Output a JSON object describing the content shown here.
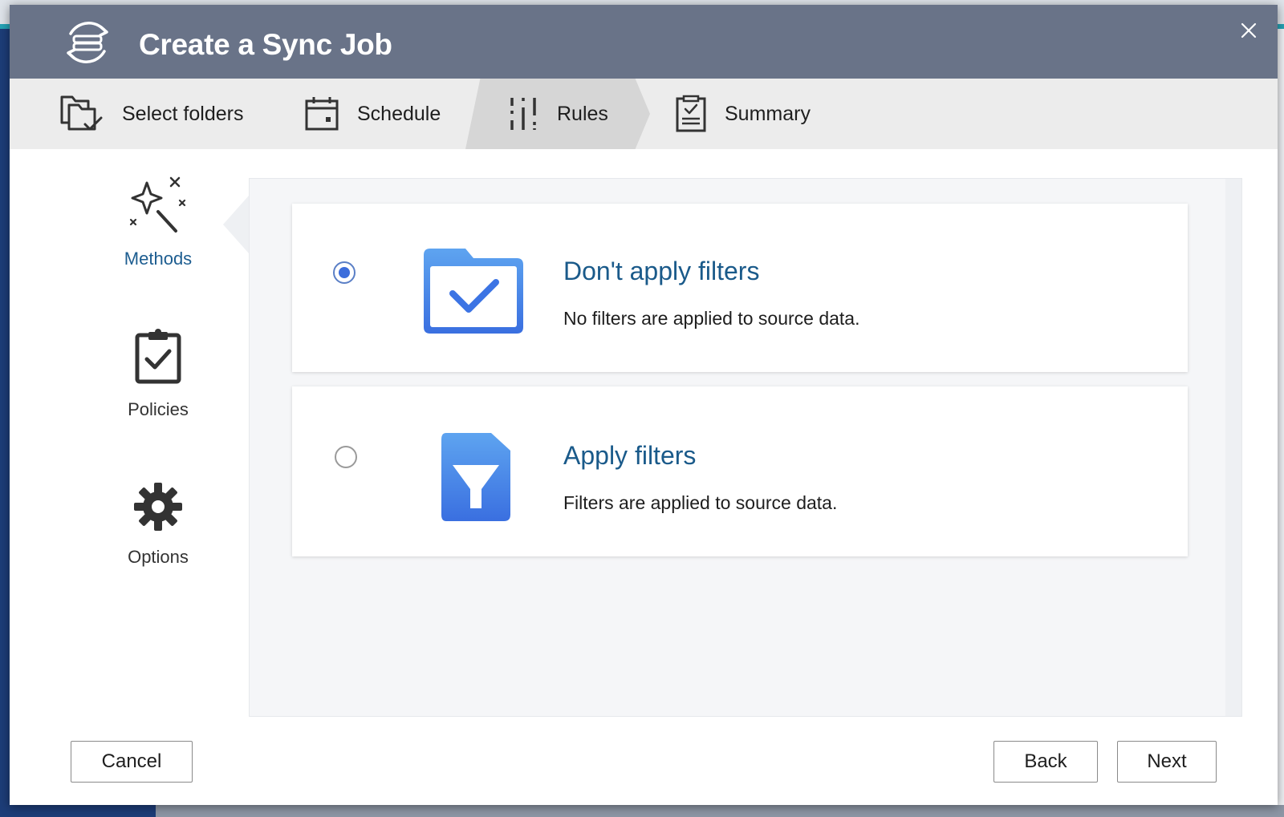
{
  "dialog": {
    "title": "Create a Sync Job",
    "app_icon": "sync-job-icon",
    "close_icon": "close-icon"
  },
  "steps": [
    {
      "label": "Select folders",
      "icon": "folders-check-icon",
      "active": false
    },
    {
      "label": "Schedule",
      "icon": "calendar-icon",
      "active": false
    },
    {
      "label": "Rules",
      "icon": "sliders-icon",
      "active": true
    },
    {
      "label": "Summary",
      "icon": "clipboard-list-icon",
      "active": false
    }
  ],
  "side_nav": [
    {
      "label": "Methods",
      "icon": "magic-wand-icon",
      "active": true
    },
    {
      "label": "Policies",
      "icon": "clipboard-check-icon",
      "active": false
    },
    {
      "label": "Options",
      "icon": "gear-icon",
      "active": false
    }
  ],
  "options": [
    {
      "title": "Don't apply filters",
      "description": "No filters are applied to source data.",
      "icon": "folder-check-icon",
      "selected": true
    },
    {
      "title": "Apply filters",
      "description": "Filters are applied to source data.",
      "icon": "file-filter-icon",
      "selected": false
    }
  ],
  "buttons": {
    "cancel": "Cancel",
    "back": "Back",
    "next": "Next"
  },
  "colors": {
    "header": "#697388",
    "accent_blue": "#3c6ddb",
    "title_blue": "#1a5a8a",
    "active_step_bg": "#d6d6d6"
  }
}
